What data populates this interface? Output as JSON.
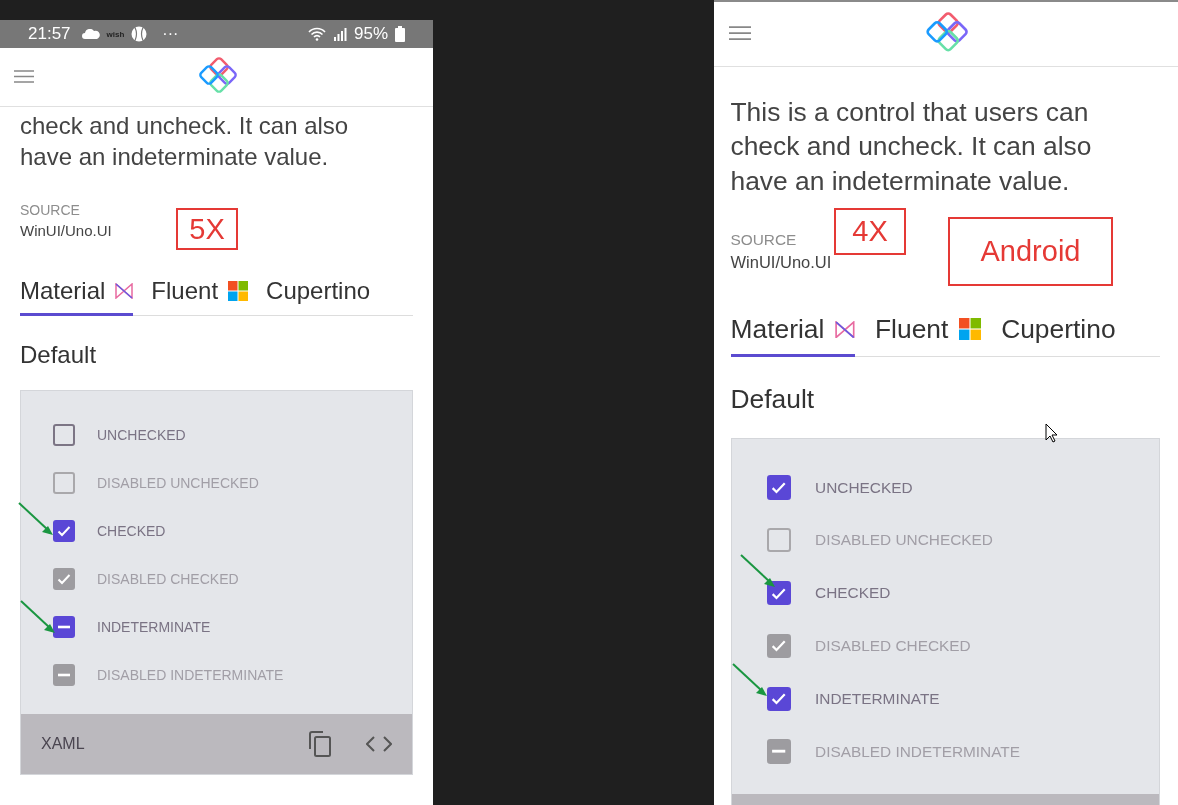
{
  "panels": [
    {
      "status_bar": {
        "time": "21:57",
        "app_label": "wish",
        "more": "···",
        "battery": "95%"
      },
      "description": "check and uncheck. It can also have an indeterminate value.",
      "annotations": [
        {
          "text": "5X"
        }
      ],
      "source_label": "SOURCE",
      "source_value": "WinUI/Uno.UI",
      "tabs": [
        {
          "label": "Material",
          "selected": true
        },
        {
          "label": "Fluent",
          "selected": false
        },
        {
          "label": "Cupertino",
          "selected": false
        }
      ],
      "section_title": "Default",
      "checkboxes": [
        {
          "label": "UNCHECKED",
          "checked": false,
          "indeterminate": false,
          "disabled": false
        },
        {
          "label": "DISABLED UNCHECKED",
          "checked": false,
          "indeterminate": false,
          "disabled": true
        },
        {
          "label": "CHECKED",
          "checked": true,
          "indeterminate": false,
          "disabled": false
        },
        {
          "label": "DISABLED CHECKED",
          "checked": true,
          "indeterminate": false,
          "disabled": true
        },
        {
          "label": "INDETERMINATE",
          "checked": true,
          "indeterminate": true,
          "disabled": false
        },
        {
          "label": "DISABLED INDETERMINATE",
          "checked": true,
          "indeterminate": true,
          "disabled": true
        }
      ],
      "footer": {
        "label": "XAML"
      }
    },
    {
      "description": "This is a control that users can check and uncheck. It can also have an indeterminate value.",
      "annotations": [
        {
          "text": "4X"
        },
        {
          "text": "Android"
        }
      ],
      "source_label": "SOURCE",
      "source_value": "WinUI/Uno.UI",
      "tabs": [
        {
          "label": "Material",
          "selected": true
        },
        {
          "label": "Fluent",
          "selected": false
        },
        {
          "label": "Cupertino",
          "selected": false
        }
      ],
      "section_title": "Default",
      "checkboxes": [
        {
          "label": "UNCHECKED",
          "checked": true,
          "indeterminate": false,
          "disabled": false
        },
        {
          "label": "DISABLED UNCHECKED",
          "checked": false,
          "indeterminate": false,
          "disabled": true
        },
        {
          "label": "CHECKED",
          "checked": true,
          "indeterminate": false,
          "disabled": false
        },
        {
          "label": "DISABLED CHECKED",
          "checked": true,
          "indeterminate": false,
          "disabled": true
        },
        {
          "label": "INDETERMINATE",
          "checked": true,
          "indeterminate": false,
          "disabled": false
        },
        {
          "label": "DISABLED INDETERMINATE",
          "checked": true,
          "indeterminate": true,
          "disabled": true
        }
      ]
    }
  ]
}
